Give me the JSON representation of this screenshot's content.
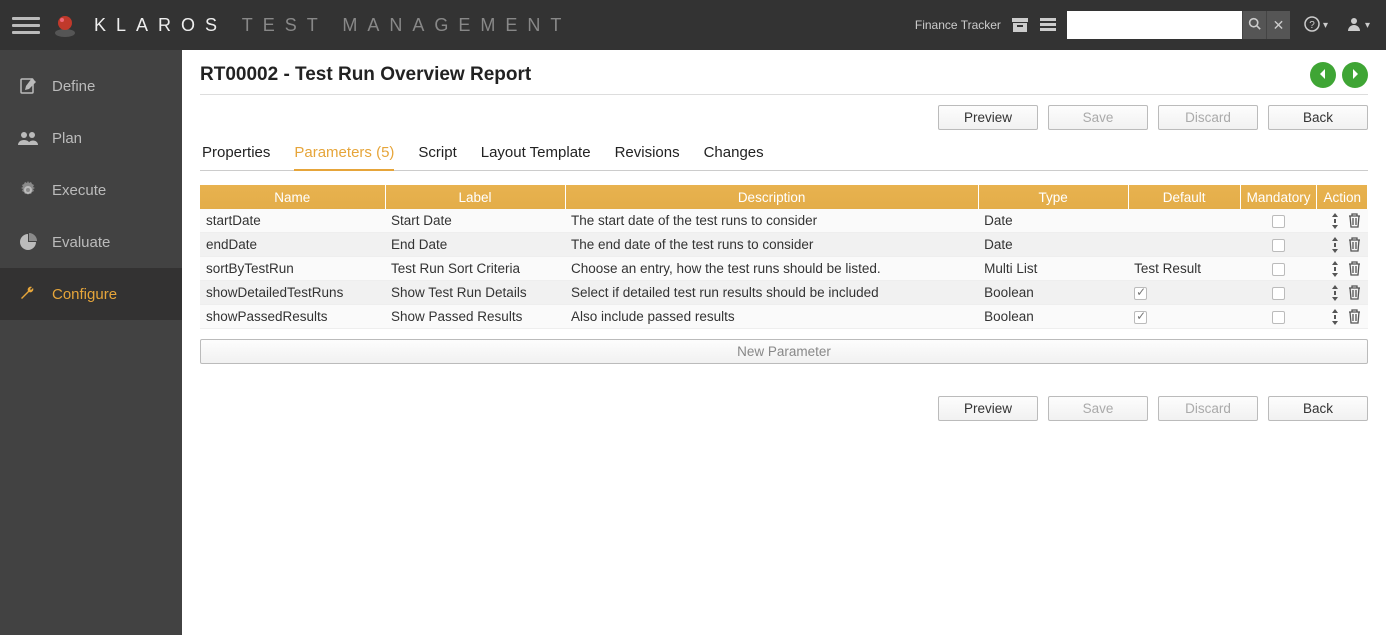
{
  "brand": {
    "left": "KLAROS",
    "right": "TEST MANAGEMENT"
  },
  "header": {
    "project_name": "Finance Tracker",
    "search_placeholder": ""
  },
  "sidebar": {
    "items": [
      {
        "id": "define",
        "label": "Define"
      },
      {
        "id": "plan",
        "label": "Plan"
      },
      {
        "id": "execute",
        "label": "Execute"
      },
      {
        "id": "evaluate",
        "label": "Evaluate"
      },
      {
        "id": "configure",
        "label": "Configure"
      }
    ],
    "active": "configure"
  },
  "page": {
    "title": "RT00002 - Test Run Overview Report"
  },
  "buttons": {
    "preview": "Preview",
    "save": "Save",
    "discard": "Discard",
    "back": "Back",
    "new_param": "New Parameter"
  },
  "tabs": [
    {
      "id": "properties",
      "label": "Properties"
    },
    {
      "id": "parameters",
      "label": "Parameters (5)"
    },
    {
      "id": "script",
      "label": "Script"
    },
    {
      "id": "layout",
      "label": "Layout Template"
    },
    {
      "id": "revisions",
      "label": "Revisions"
    },
    {
      "id": "changes",
      "label": "Changes"
    }
  ],
  "active_tab": "parameters",
  "table": {
    "headers": {
      "name": "Name",
      "label": "Label",
      "description": "Description",
      "type": "Type",
      "default": "Default",
      "mandatory": "Mandatory",
      "action": "Action"
    },
    "rows": [
      {
        "name": "startDate",
        "label": "Start Date",
        "description": "The start date of the test runs to consider",
        "type": "Date",
        "default": "",
        "default_checked": false,
        "mandatory": false
      },
      {
        "name": "endDate",
        "label": "End Date",
        "description": "The end date of the test runs to consider",
        "type": "Date",
        "default": "",
        "default_checked": false,
        "mandatory": false
      },
      {
        "name": "sortByTestRun",
        "label": "Test Run Sort Criteria",
        "description": "Choose an entry, how the test runs should be listed.",
        "type": "Multi List",
        "default": "Test Result",
        "default_checked": false,
        "mandatory": false
      },
      {
        "name": "showDetailedTestRuns",
        "label": "Show Test Run Details",
        "description": "Select if detailed test run results should be included",
        "type": "Boolean",
        "default": "",
        "default_checked": true,
        "mandatory": false
      },
      {
        "name": "showPassedResults",
        "label": "Show Passed Results",
        "description": "Also include passed results",
        "type": "Boolean",
        "default": "",
        "default_checked": true,
        "mandatory": false
      }
    ]
  }
}
